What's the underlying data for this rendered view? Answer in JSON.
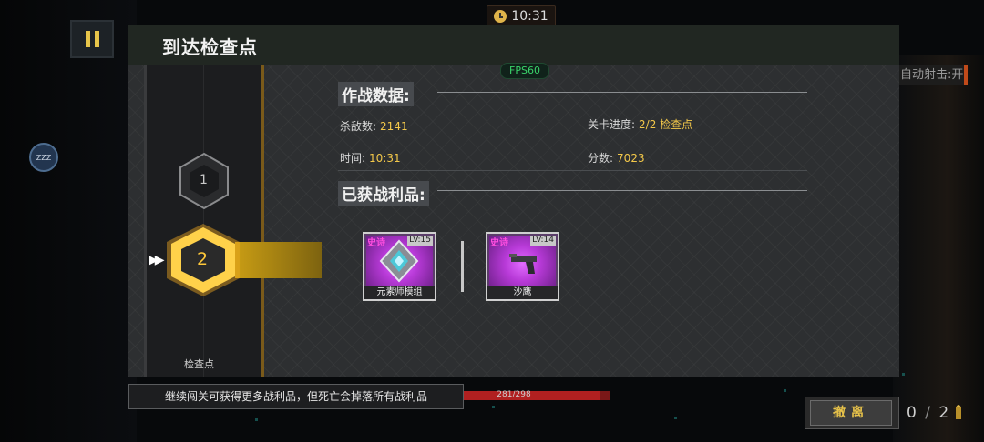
{
  "hud": {
    "clock": "10:31",
    "auto_fire": "自动射击:开",
    "fps": "FPS60",
    "zzz": "ZZZ",
    "hp_text": "281/298",
    "ammo_current": "0",
    "ammo_separator": "/",
    "ammo_max": "2",
    "hp_fraction": 0.94
  },
  "panel": {
    "title": "到达检查点",
    "combat_section_title": "作战数据:",
    "stats": {
      "kills_label": "杀敌数:",
      "kills_value": "2141",
      "progress_label": "关卡进度:",
      "progress_value": "2/2 检查点",
      "time_label": "时间:",
      "time_value": "10:31",
      "score_label": "分数:",
      "score_value": "7023"
    },
    "loot_section_title": "已获战利品:",
    "loot": [
      {
        "rarity": "史诗",
        "level": "LV:15",
        "name": "元素师模组",
        "icon": "elementalist-module-icon"
      },
      {
        "rarity": "史诗",
        "level": "LV:14",
        "name": "沙鹰",
        "icon": "desert-eagle-pistol-icon"
      }
    ]
  },
  "checkpoints": {
    "nodes": [
      {
        "number": "1",
        "state": "passed"
      },
      {
        "number": "2",
        "state": "current"
      }
    ],
    "label": "检查点"
  },
  "hint": "继续闯关可获得更多战利品，但死亡会掉落所有战利品",
  "evacuate_button": "撤离",
  "colors": {
    "accent_gold": "#f3c84a",
    "epic_purple": "#b83ad8",
    "fps_green": "#3ad36a",
    "hp_red": "#b02020"
  }
}
